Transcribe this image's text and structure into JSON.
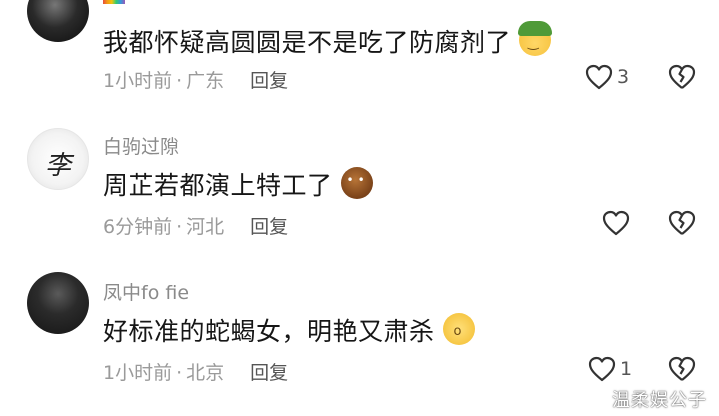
{
  "comments": [
    {
      "username": "",
      "text": "我都怀疑高圆圆是不是吃了防腐剂了",
      "emoji": "smirking-face-with-green-hat",
      "time": "1小时前",
      "location": "广东",
      "reply_label": "回复",
      "like_count": "3"
    },
    {
      "username": "白驹过隙",
      "avatar_char": "李",
      "text": "周芷若都演上特工了",
      "emoji": "brown-round-face",
      "time": "6分钟前",
      "location": "河北",
      "reply_label": "回复",
      "like_count": ""
    },
    {
      "username": "凤中fo fie",
      "text": "好标准的蛇蝎女，明艳又肃杀",
      "emoji": "shocked-face",
      "time": "1小时前",
      "location": "北京",
      "reply_label": "回复",
      "like_count": "1"
    }
  ],
  "separator": "·",
  "watermark": "温柔娱公子",
  "colors": {
    "meta_text": "#9a9a9a",
    "username": "#8a8a8a",
    "comment_text": "#161616"
  }
}
